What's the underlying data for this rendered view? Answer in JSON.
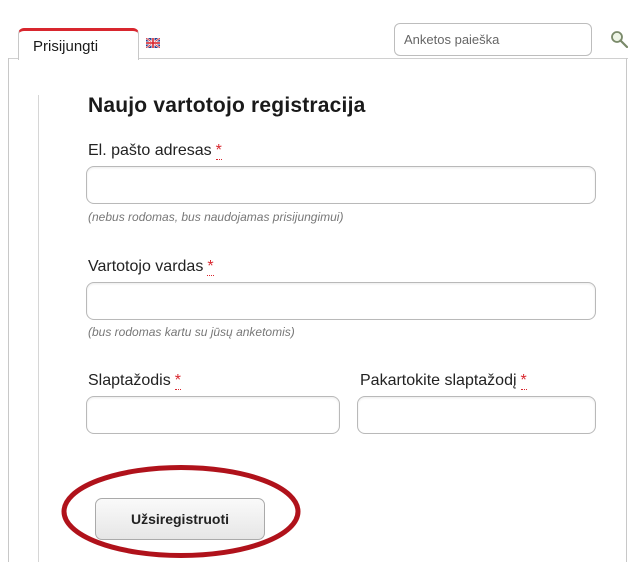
{
  "tabs": {
    "login_label": "Prisijungti",
    "language_icon": "uk-flag-icon"
  },
  "search": {
    "placeholder": "Anketos paieška",
    "icon": "magnifier-icon"
  },
  "form": {
    "title": "Naujo vartotojo registracija",
    "required_mark": "*",
    "email": {
      "label": "El. pašto adresas",
      "value": "",
      "hint": "(nebus rodomas, bus naudojamas prisijungimui)"
    },
    "username": {
      "label": "Vartotojo vardas",
      "value": "",
      "hint": "(bus rodomas kartu su jūsų anketomis)"
    },
    "password": {
      "label": "Slaptažodis",
      "value": ""
    },
    "password_repeat": {
      "label": "Pakartokite slaptažodį",
      "value": ""
    },
    "submit_label": "Užsiregistruoti"
  },
  "colors": {
    "accent_red": "#d8262e",
    "highlight_ellipse": "#b0121b"
  }
}
